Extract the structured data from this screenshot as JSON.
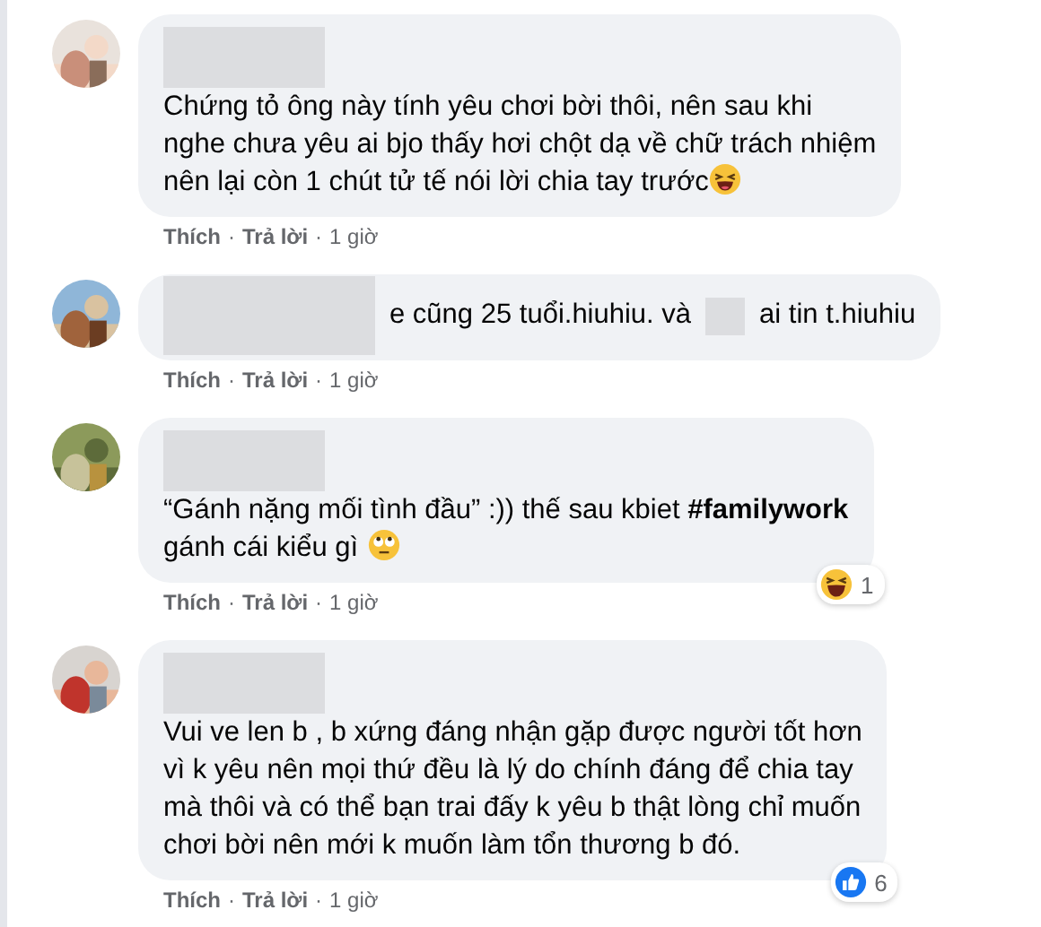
{
  "comments": [
    {
      "avatar": {
        "kind": "picture"
      },
      "body": [
        {
          "kind": "name_blur"
        },
        {
          "kind": "para",
          "text": "Chứng tỏ ông này tính yêu chơi bời thôi, nên sau khi\nnghe chưa yêu ai bjo thấy hơi chột dạ về chữ trách nhiệm"
        },
        {
          "kind": "text",
          "text": "nên lại còn 1 chút tử tế nói lời chia tay trước"
        },
        {
          "kind": "grin_emoji"
        }
      ],
      "actions": [
        {
          "kind": "link",
          "text": "Thích"
        },
        {
          "kind": "dot",
          "text": "·"
        },
        {
          "kind": "link",
          "text": "Trả lời"
        },
        {
          "kind": "dot",
          "text": "·"
        },
        {
          "kind": "time",
          "text": "1 giờ"
        }
      ]
    },
    {
      "avatar": {
        "kind": "picture"
      },
      "body": [
        {
          "kind": "blur_large"
        },
        {
          "kind": "text",
          "text": "e cũng 25 tuổi.hiuhiu. và"
        },
        {
          "kind": "blur_small"
        },
        {
          "kind": "text",
          "text": "ai tin t.hiuhiu"
        }
      ],
      "actions": [
        {
          "kind": "link",
          "text": "Thích"
        },
        {
          "kind": "dot",
          "text": "·"
        },
        {
          "kind": "link",
          "text": "Trả lời"
        },
        {
          "kind": "dot",
          "text": "·"
        },
        {
          "kind": "time",
          "text": "1 giờ"
        }
      ]
    },
    {
      "avatar": {
        "kind": "picture"
      },
      "body": [
        {
          "kind": "name_blur"
        },
        {
          "kind": "para",
          "text": "“Gánh nặng mối tình đầu” :)) thế sau kbiet **#familywork**"
        },
        {
          "kind": "text",
          "text": "gánh cái kiểu gì"
        },
        {
          "kind": "eyeroll_emoji"
        }
      ],
      "reaction": {
        "kind": "haha",
        "count": "1"
      },
      "actions": [
        {
          "kind": "link",
          "text": "Thích"
        },
        {
          "kind": "dot",
          "text": "·"
        },
        {
          "kind": "link",
          "text": "Trả lời"
        },
        {
          "kind": "dot",
          "text": "·"
        },
        {
          "kind": "time",
          "text": "1 giờ"
        }
      ]
    },
    {
      "avatar": {
        "kind": "picture"
      },
      "body": [
        {
          "kind": "name_blur"
        },
        {
          "kind": "para",
          "text": "Vui ve len b , b xứng đáng nhận gặp được người tốt hơn\nvì k yêu nên mọi thứ đều là lý do chính đáng để chia tay\nmà thôi và có thể bạn trai đấy k yêu b thật lòng chỉ muốn\nchơi bời nên mới k muốn làm tổn thương b đó."
        }
      ],
      "reaction": {
        "kind": "like",
        "count": "6"
      },
      "actions": [
        {
          "kind": "link",
          "text": "Thích"
        },
        {
          "kind": "dot",
          "text": "·"
        },
        {
          "kind": "link",
          "text": "Trả lời"
        },
        {
          "kind": "dot",
          "text": "·"
        },
        {
          "kind": "time",
          "text": "1 giờ"
        }
      ]
    }
  ]
}
